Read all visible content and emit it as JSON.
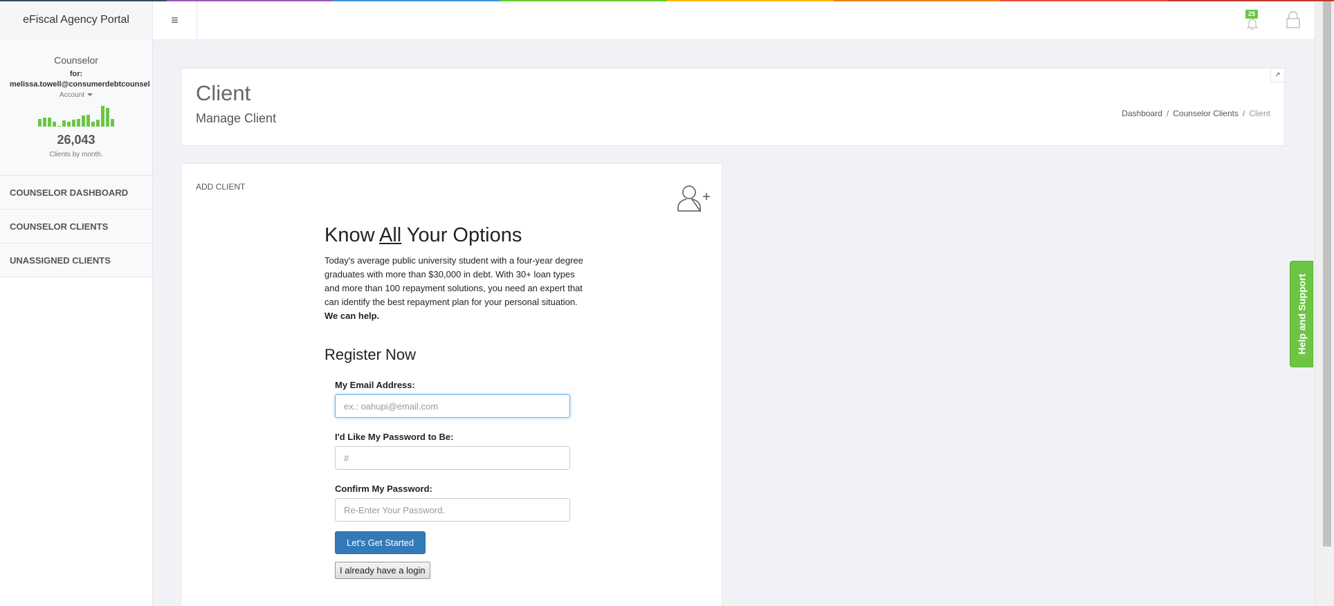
{
  "app": {
    "brand": "eFiscal Agency Portal"
  },
  "colors": {
    "accent_green": "#6cc644",
    "primary_blue": "#337ab7",
    "rainbow": [
      "#34495e",
      "#9b59b6",
      "#3498db",
      "#62cb31",
      "#ffb606",
      "#e67e22",
      "#e74c3c",
      "#c0392b"
    ]
  },
  "topbar": {
    "menu_icon": "hamburger-icon",
    "notifications": {
      "count": "25",
      "icon": "bell-icon"
    },
    "lock_icon": "lock-icon"
  },
  "sidebar": {
    "role": "Counselor",
    "for_label": "for:",
    "email": "melissa.towell@consumerdebtcounsel",
    "account_label": "Account",
    "sparkline": [
      10,
      12,
      12,
      6,
      1,
      8,
      6,
      9,
      10,
      14,
      15,
      6,
      9,
      27,
      24,
      10
    ],
    "client_count": "26,043",
    "client_count_label": "Clients by month.",
    "items": [
      {
        "label": "COUNSELOR DASHBOARD"
      },
      {
        "label": "COUNSELOR CLIENTS"
      },
      {
        "label": "UNASSIGNED CLIENTS"
      }
    ]
  },
  "header": {
    "title": "Client",
    "subtitle": "Manage Client",
    "breadcrumb": [
      "Dashboard",
      "Counselor Clients",
      "Client"
    ]
  },
  "panel": {
    "title": "ADD CLIENT",
    "icon": "add-user-icon"
  },
  "form": {
    "heading_pre": "Know ",
    "heading_underlined": "All",
    "heading_post": " Your Options",
    "intro": "Today's average public university student with a four-year degree graduates with more than $30,000 in debt. With 30+ loan types and more than 100 repayment solutions, you need an expert that can identify the best repayment plan for your personal situation. ",
    "intro_bold": "We can help.",
    "register_heading": "Register Now",
    "email_label": "My Email Address:",
    "email_placeholder": "ex.: oahupi@email.com",
    "password_label": "I'd Like My Password to Be:",
    "password_placeholder": "#",
    "confirm_label": "Confirm My Password:",
    "confirm_placeholder": "Re-Enter Your Password.",
    "submit_label": "Let's Get Started",
    "login_label": "I already have a login"
  },
  "help_tab": {
    "label": "Help and Support"
  }
}
